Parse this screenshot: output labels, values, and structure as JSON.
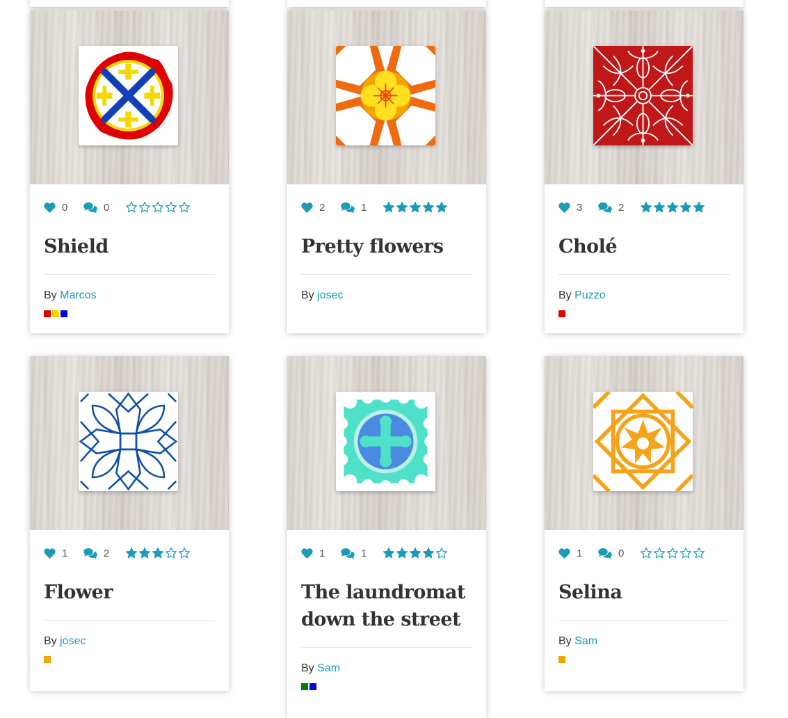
{
  "cards": [
    {
      "title": "Shield",
      "likes": "0",
      "comments": "0",
      "rating": 0,
      "by_label": "By",
      "author": "Marcos",
      "colors": [
        "#e00000",
        "#f5d800",
        "#0000ee"
      ]
    },
    {
      "title": "Pretty flowers",
      "likes": "2",
      "comments": "1",
      "rating": 5,
      "by_label": "By",
      "author": "josec",
      "colors": []
    },
    {
      "title": "Cholé",
      "likes": "3",
      "comments": "2",
      "rating": 5,
      "by_label": "By",
      "author": "Puzzo",
      "colors": [
        "#e00000"
      ]
    },
    {
      "title": "Flower",
      "likes": "1",
      "comments": "2",
      "rating": 3,
      "by_label": "By",
      "author": "josec",
      "colors": [
        "#f5a300"
      ]
    },
    {
      "title": "The laundromat down the street",
      "likes": "1",
      "comments": "1",
      "rating": 4,
      "by_label": "By",
      "author": "Sam",
      "colors": [
        "#008000",
        "#0000ee"
      ]
    },
    {
      "title": "Selina",
      "likes": "1",
      "comments": "0",
      "rating": 0,
      "by_label": "By",
      "author": "Sam",
      "colors": [
        "#f5a300"
      ]
    }
  ],
  "accent_color": "#1a9bb8",
  "icons": {
    "like": "heart-icon",
    "comment": "comments-icon",
    "rating": "star-icon"
  }
}
